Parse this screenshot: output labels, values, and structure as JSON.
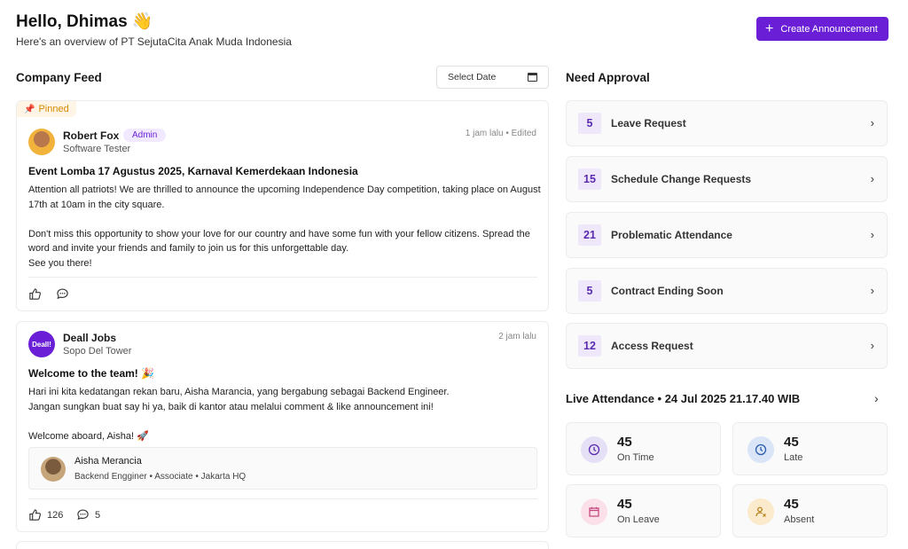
{
  "header": {
    "greeting": "Hello, Dhimas 👋",
    "subtitle": "Here's an overview of PT SejutaCita Anak Muda Indonesia",
    "create_button": "Create Announcement",
    "accent_color": "#6a1fd6"
  },
  "feed": {
    "title": "Company Feed",
    "date_placeholder": "Select Date",
    "posts": [
      {
        "pinned_label": "Pinned",
        "author": "Robert Fox",
        "badge": "Admin",
        "role": "Software Tester",
        "time": "1 jam lalu • Edited",
        "title": "Event Lomba 17 Agustus 2025, Karnaval Kemerdekaan Indonesia",
        "body": [
          "Attention all patriots! We are thrilled to announce the upcoming Independence Day competition, taking place on August 17th at 10am in the city square.",
          "",
          "Don't miss this opportunity to show your love for our country and have some fun with your fellow citizens. Spread the word and invite your friends and family to join us for this unforgettable day.",
          "See you there!"
        ]
      },
      {
        "author": "Deall Jobs",
        "avatar_text": "Deall!",
        "role": "Sopo Del Tower",
        "time": "2 jam lalu",
        "title": "Welcome to the team! 🎉",
        "body": [
          "Hari ini kita kedatangan rekan baru, Aisha Marancia, yang bergabung sebagai Backend Engineer.",
          "Jangan sungkan buat say hi ya, baik di kantor atau melalui comment & like announcement ini!",
          "",
          "Welcome aboard, Aisha! 🚀"
        ],
        "mention": {
          "name": "Aisha Merancia",
          "meta": "Backend Engginer • Associate • Jakarta HQ"
        },
        "likes": "126",
        "comments": "5"
      }
    ]
  },
  "approval": {
    "title": "Need Approval",
    "items": [
      {
        "count": "5",
        "label": "Leave Request"
      },
      {
        "count": "15",
        "label": "Schedule Change Requests"
      },
      {
        "count": "21",
        "label": "Problematic Attendance"
      },
      {
        "count": "5",
        "label": "Contract Ending Soon"
      },
      {
        "count": "12",
        "label": "Access Request"
      }
    ]
  },
  "live": {
    "title": "Live Attendance • 24 Jul 2025 21.17.40 WIB",
    "stats": [
      {
        "value": "45",
        "label": "On Time",
        "icon": "clock-icon",
        "color": "#e6e0f7"
      },
      {
        "value": "45",
        "label": "Late",
        "icon": "late-clock-icon",
        "color": "#dbe5f8"
      },
      {
        "value": "45",
        "label": "On Leave",
        "icon": "calendar-icon",
        "color": "#fbe0ea"
      },
      {
        "value": "45",
        "label": "Absent",
        "icon": "absent-user-icon",
        "color": "#fbeacc"
      }
    ]
  }
}
